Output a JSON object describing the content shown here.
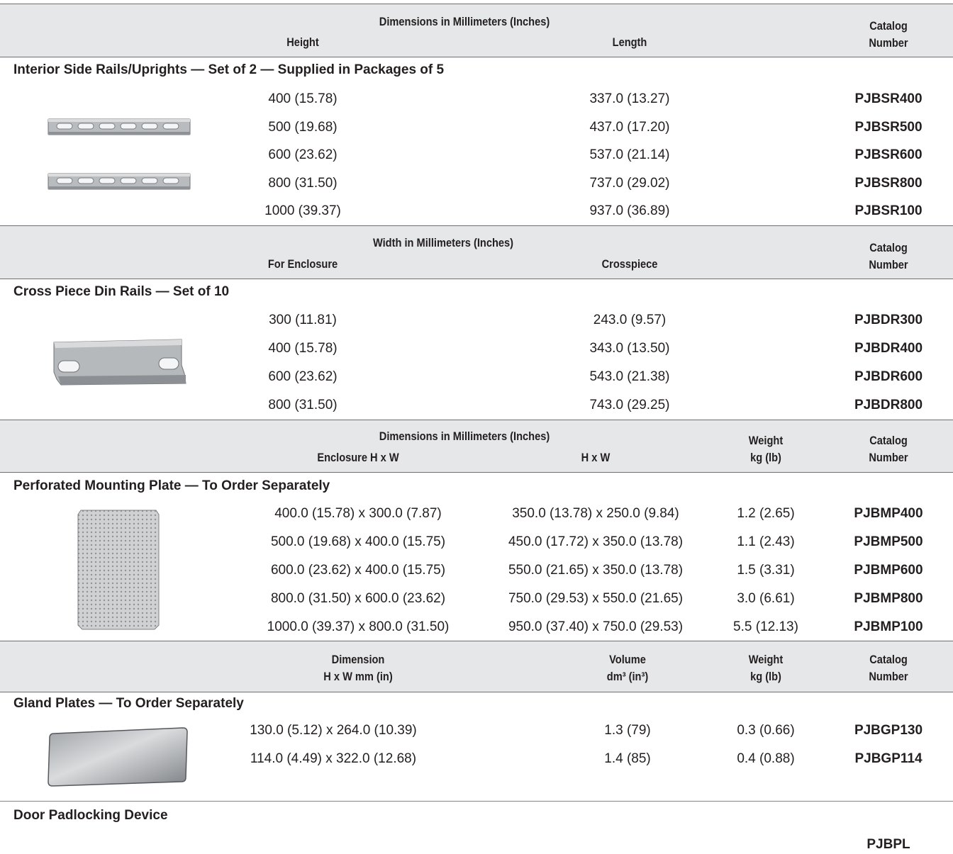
{
  "colors": {
    "header_bg": "#e6e7e8",
    "rule": "#808285",
    "text": "#231f20"
  },
  "sections": [
    {
      "header": {
        "group": "Dimensions in Millimeters (Inches)",
        "col1": "Height",
        "col2": "Length",
        "catalog": "Catalog\nNumber"
      },
      "title": "Interior Side Rails/Uprights — Set of 2 — Supplied in Packages of 5",
      "image": "side-rails-image",
      "rows": [
        {
          "a": "400 (15.78)",
          "b": "337.0 (13.27)",
          "cat": "PJBSR400"
        },
        {
          "a": "500 (19.68)",
          "b": "437.0 (17.20)",
          "cat": "PJBSR500"
        },
        {
          "a": "600 (23.62)",
          "b": "537.0 (21.14)",
          "cat": "PJBSR600"
        },
        {
          "a": "800 (31.50)",
          "b": "737.0 (29.02)",
          "cat": "PJBSR800"
        },
        {
          "a": "1000 (39.37)",
          "b": "937.0 (36.89)",
          "cat": "PJBSR100"
        }
      ]
    },
    {
      "header": {
        "group": "Width in Millimeters (Inches)",
        "col1": "For Enclosure",
        "col2": "Crosspiece",
        "catalog": "Catalog\nNumber"
      },
      "title": "Cross Piece Din Rails — Set of 10",
      "image": "din-rail-image",
      "rows": [
        {
          "a": "300 (11.81)",
          "b": "243.0 (9.57)",
          "cat": "PJBDR300"
        },
        {
          "a": "400 (15.78)",
          "b": "343.0 (13.50)",
          "cat": "PJBDR400"
        },
        {
          "a": "600 (23.62)",
          "b": "543.0 (21.38)",
          "cat": "PJBDR600"
        },
        {
          "a": "800 (31.50)",
          "b": "743.0 (29.25)",
          "cat": "PJBDR800"
        }
      ]
    },
    {
      "header": {
        "group": "Dimensions in Millimeters (Inches)",
        "col1": "Enclosure H x W",
        "col2": "H x W",
        "col3": "Weight\nkg (lb)",
        "catalog": "Catalog\nNumber"
      },
      "title": "Perforated Mounting Plate — To Order Separately",
      "image": "mounting-plate-image",
      "rows": [
        {
          "a": "400.0 (15.78) x 300.0 (7.87)",
          "b": "350.0 (13.78) x 250.0 (9.84)",
          "c": "1.2 (2.65)",
          "cat": "PJBMP400"
        },
        {
          "a": "500.0 (19.68) x 400.0 (15.75)",
          "b": "450.0 (17.72) x 350.0 (13.78)",
          "c": "1.1 (2.43)",
          "cat": "PJBMP500"
        },
        {
          "a": "600.0 (23.62) x 400.0 (15.75)",
          "b": "550.0 (21.65) x 350.0 (13.78)",
          "c": "1.5 (3.31)",
          "cat": "PJBMP600"
        },
        {
          "a": "800.0 (31.50) x 600.0 (23.62)",
          "b": "750.0 (29.53) x 550.0 (21.65)",
          "c": "3.0 (6.61)",
          "cat": "PJBMP800"
        },
        {
          "a": "1000.0 (39.37) x 800.0 (31.50)",
          "b": "950.0 (37.40) x 750.0 (29.53)",
          "c": "5.5 (12.13)",
          "cat": "PJBMP100"
        }
      ]
    },
    {
      "header": {
        "col1": "Dimension\nH x W mm (in)",
        "col2": "Volume\ndm³ (in³)",
        "col3": "Weight\nkg (lb)",
        "catalog": "Catalog\nNumber"
      },
      "title": "Gland Plates — To Order Separately",
      "image": "gland-plate-image",
      "rows": [
        {
          "a": "130.0 (5.12) x 264.0 (10.39)",
          "b": "1.3 (79)",
          "c": "0.3 (0.66)",
          "cat": "PJBGP130"
        },
        {
          "a": "114.0 (4.49) x 322.0 (12.68)",
          "b": "1.4 (85)",
          "c": "0.4 (0.88)",
          "cat": "PJBGP114"
        }
      ]
    },
    {
      "title": "Door Padlocking Device",
      "rows": [
        {
          "cat": "PJBPL"
        }
      ]
    }
  ]
}
